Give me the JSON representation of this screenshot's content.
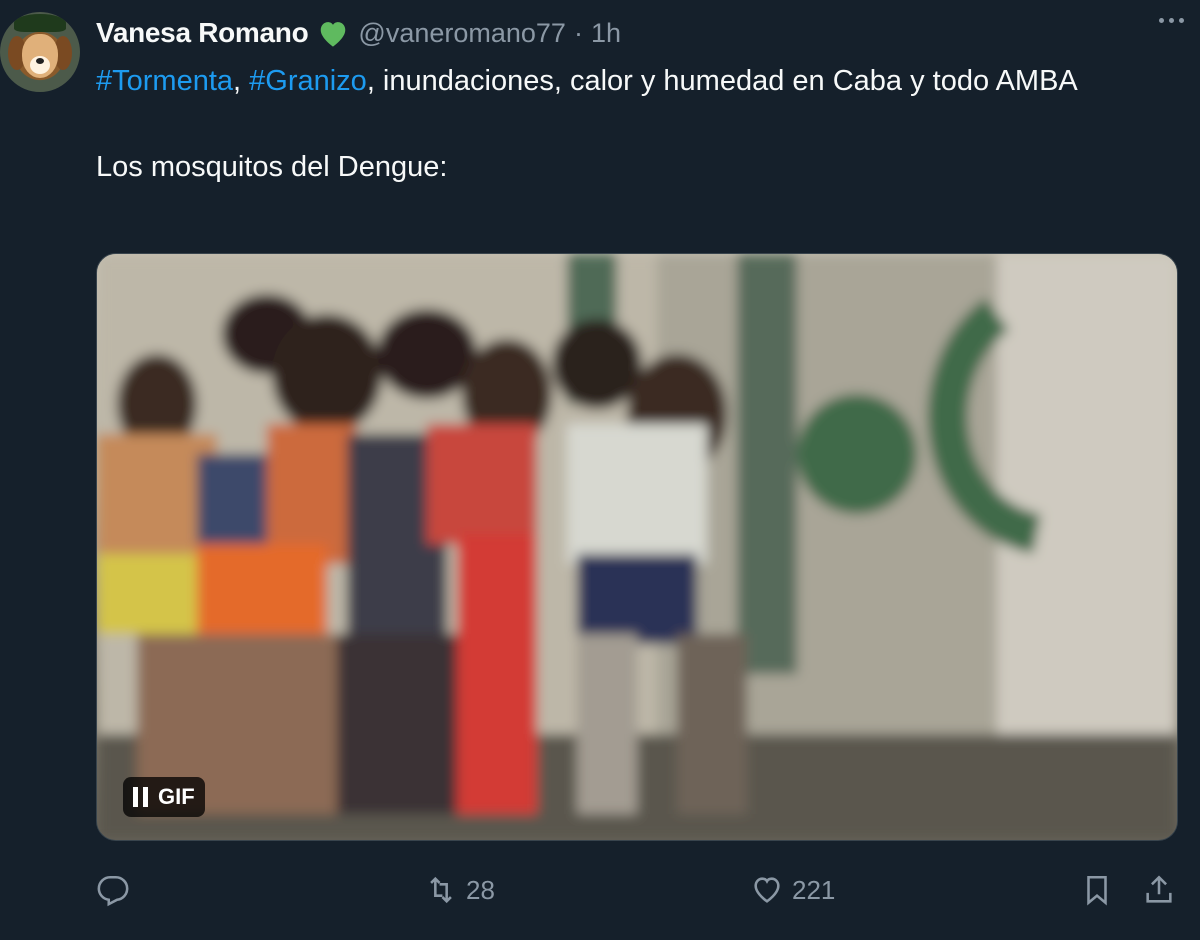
{
  "tweet": {
    "author_name": "Vanesa Romano",
    "handle": "@vaneromano77",
    "separator": "·",
    "time": "1h",
    "text_tag1": "#Tormenta",
    "text_sep1": ", ",
    "text_tag2": "#Granizo",
    "text_rest": ", inundaciones, calor  y humedad en Caba y todo AMBA",
    "text_para2": "Los mosquitos del Dengue:",
    "media_badge": "GIF",
    "icons": {
      "verified": "green-heart-icon",
      "more": "more-icon",
      "reply": "reply-icon",
      "retweet": "retweet-icon",
      "like": "heart-icon",
      "bookmark": "bookmark-icon",
      "share": "share-icon",
      "pause": "pause-icon"
    },
    "counts": {
      "retweets": "28",
      "likes": "221"
    }
  },
  "colors": {
    "background": "#15202b",
    "text": "#f7f9f9",
    "muted": "#8b98a5",
    "link": "#1d9bf0",
    "heart_badge": "#5fba5f"
  }
}
